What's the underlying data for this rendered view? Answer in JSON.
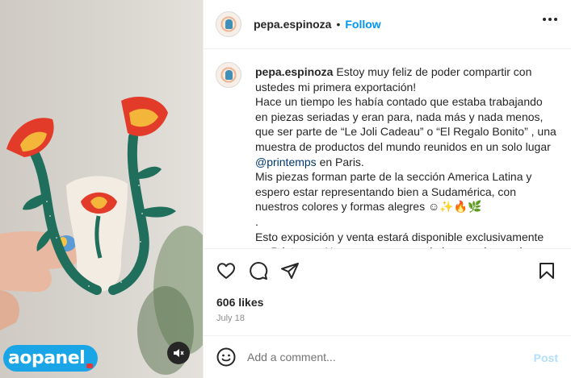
{
  "header": {
    "username": "pepa.espinoza",
    "separator": "•",
    "follow_label": "Follow"
  },
  "caption": {
    "username": "pepa.espinoza",
    "line1": "Estoy muy feliz de poder compartir con ustedes mi primera exportación!",
    "line2": "Hace un tiempo les había contado que estaba trabajando en piezas seriadas y eran para, nada más y nada menos, que ser parte de “Le Joli Cadeau” o “El Regalo Bonito” , una muestra de productos del mundo reunidos en un solo lugar",
    "mention": "@printemps",
    "line2_end": " en Paris.",
    "line3": "Mis piezas forman parte de la sección America Latina y espero estar representando bien a Sudamérica, con nuestros colores y formas alegres ☺✨🔥🌿",
    "line4": ".",
    "line5": "Esto exposición y venta estará disponible exclusivamente en Printemps Haussmann en uno de las esquinas más"
  },
  "stats": {
    "likes": "606 likes",
    "date": "July 18"
  },
  "comment": {
    "placeholder": "Add a comment...",
    "post_label": "Post"
  },
  "watermark": {
    "text": "aopanel"
  },
  "icons": {
    "more": "more-options-icon",
    "like": "heart-icon",
    "comment": "comment-icon",
    "share": "share-icon",
    "save": "bookmark-icon",
    "emoji": "emoji-icon",
    "mute": "muted-speaker-icon"
  },
  "colors": {
    "accent": "#0095f6",
    "mention": "#00376b",
    "post_disabled": "#b2dffc",
    "watermark": "#1aa6e6"
  }
}
